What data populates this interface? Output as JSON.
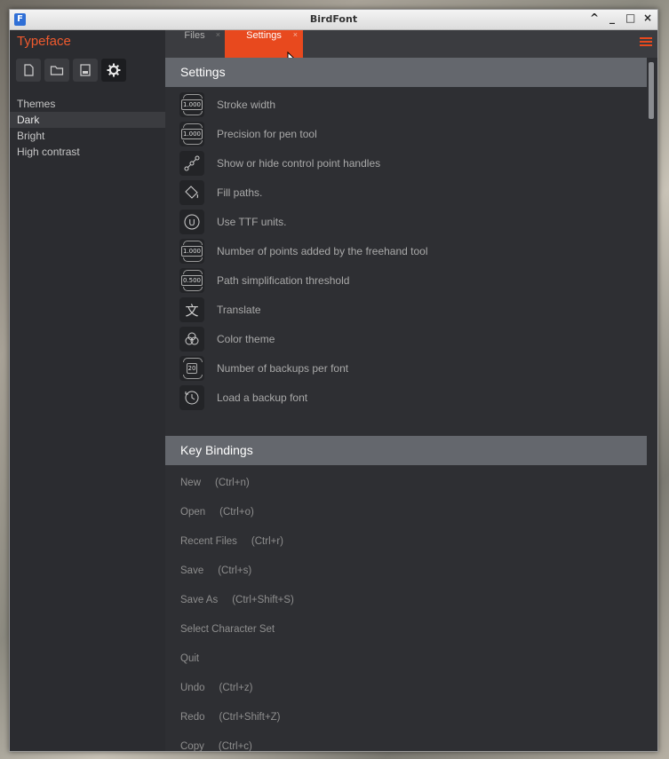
{
  "window": {
    "title": "BirdFont",
    "buttons": [
      "^",
      "_",
      "□",
      "×"
    ]
  },
  "sidebar": {
    "brand": "Typeface",
    "toolbar_icons": [
      "new-file-icon",
      "folder-icon",
      "save-icon",
      "gear-icon"
    ],
    "themes_heading": "Themes",
    "themes": [
      "Dark",
      "Bright",
      "High contrast"
    ],
    "selected_theme": "Dark"
  },
  "tabs": [
    {
      "label": "Files",
      "close": "×"
    },
    {
      "label": "Settings",
      "close": "×",
      "active": true
    }
  ],
  "settings": {
    "heading": "Settings",
    "items": [
      {
        "icon": "number-stepper-icon",
        "value": "1.000",
        "label": "Stroke width"
      },
      {
        "icon": "number-stepper-icon",
        "value": "1.000",
        "label": "Precision for pen tool"
      },
      {
        "icon": "control-handles-icon",
        "label": "Show or hide control point handles"
      },
      {
        "icon": "fill-paths-icon",
        "label": "Fill paths."
      },
      {
        "icon": "ttf-units-icon",
        "glyph": "U",
        "label": "Use TTF units."
      },
      {
        "icon": "number-stepper-icon",
        "value": "1.000",
        "label": "Number of points added by the freehand tool"
      },
      {
        "icon": "number-stepper-icon",
        "value": "0.500",
        "label": "Path simplification threshold"
      },
      {
        "icon": "translate-icon",
        "glyph": "文",
        "label": "Translate"
      },
      {
        "icon": "color-theme-icon",
        "label": "Color theme"
      },
      {
        "icon": "number-stepper-icon",
        "value": "20",
        "label": "Number of backups per font"
      },
      {
        "icon": "backup-clock-icon",
        "label": "Load a backup font"
      }
    ]
  },
  "key_bindings": {
    "heading": "Key Bindings",
    "items": [
      {
        "action": "New",
        "shortcut": "(Ctrl+n)"
      },
      {
        "action": "Open",
        "shortcut": "(Ctrl+o)"
      },
      {
        "action": "Recent Files",
        "shortcut": "(Ctrl+r)"
      },
      {
        "action": "Save",
        "shortcut": "(Ctrl+s)"
      },
      {
        "action": "Save As",
        "shortcut": "(Ctrl+Shift+S)"
      },
      {
        "action": "Select Character Set",
        "shortcut": ""
      },
      {
        "action": "Quit",
        "shortcut": ""
      },
      {
        "action": "Undo",
        "shortcut": "(Ctrl+z)"
      },
      {
        "action": "Redo",
        "shortcut": "(Ctrl+Shift+Z)"
      },
      {
        "action": "Copy",
        "shortcut": "(Ctrl+c)"
      }
    ]
  },
  "colors": {
    "accent": "#e8491e",
    "brand": "#ef5a2e",
    "background": "#2e2f33",
    "section_header": "#64676d"
  }
}
